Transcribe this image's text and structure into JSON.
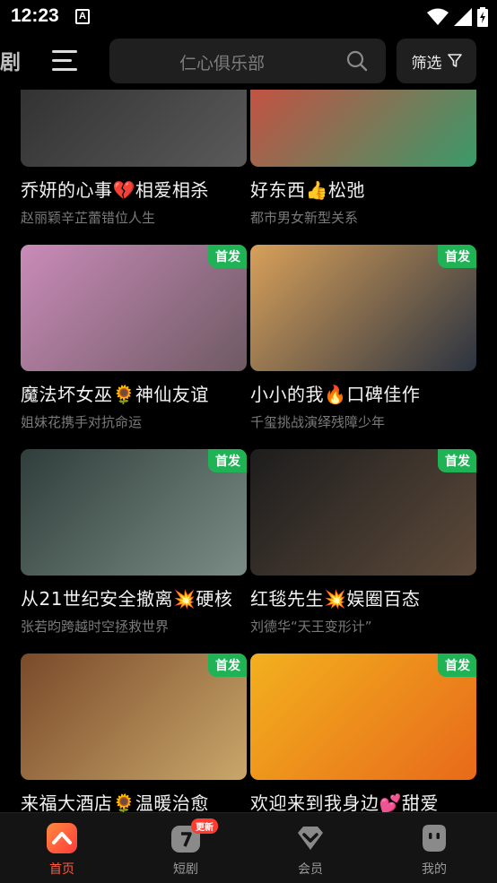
{
  "status_bar": {
    "time": "12:23",
    "notification_letter": "A"
  },
  "header": {
    "tab_partial": "剧",
    "search_placeholder": "仁心俱乐部",
    "filter_label": "筛选"
  },
  "cards": [
    {
      "title": "乔妍的心事💔相爱相杀",
      "subtitle": "赵丽颖辛芷蕾错位人生",
      "badge": "",
      "colors": [
        "#2c2c2c",
        "#5a5a5a"
      ]
    },
    {
      "title": "好东西👍松弛",
      "subtitle": "都市男女新型关系",
      "badge": "",
      "colors": [
        "#d9473c",
        "#3a9a6a"
      ]
    },
    {
      "title": "魔法坏女巫🌻神仙友谊",
      "subtitle": "姐妹花携手对抗命运",
      "badge": "首发",
      "colors": [
        "#c98bb8",
        "#6e5a63"
      ]
    },
    {
      "title": "小小的我🔥口碑佳作",
      "subtitle": "千玺挑战演绎残障少年",
      "badge": "首发",
      "colors": [
        "#d8a05a",
        "#2b3340"
      ]
    },
    {
      "title": "从21世纪安全撤离💥硬核",
      "subtitle": "张若昀跨越时空拯救世界",
      "badge": "首发",
      "colors": [
        "#2f3e3a",
        "#7b8c86"
      ]
    },
    {
      "title": "红毯先生💥娱圈百态",
      "subtitle": "刘德华“天王变形计”",
      "badge": "首发",
      "colors": [
        "#1d1d1d",
        "#5d4a3a"
      ]
    },
    {
      "title": "来福大酒店🌻温暖治愈",
      "subtitle": "",
      "badge": "首发",
      "colors": [
        "#7a4a2a",
        "#c9a76a"
      ]
    },
    {
      "title": "欢迎来到我身边💕甜爱",
      "subtitle": "",
      "badge": "首发",
      "colors": [
        "#f2b01e",
        "#e86a1a"
      ]
    }
  ],
  "bottom_nav": [
    {
      "label": "首页",
      "icon": "home-icon",
      "active": true
    },
    {
      "label": "短剧",
      "icon": "short-drama-icon",
      "active": false
    },
    {
      "label": "会员",
      "icon": "vip-icon",
      "active": false
    },
    {
      "label": "我的",
      "icon": "profile-icon",
      "active": false
    }
  ],
  "short_drama_badge": "更新",
  "accent_color": "#ff5a3c",
  "badge_color": "#1fb356"
}
